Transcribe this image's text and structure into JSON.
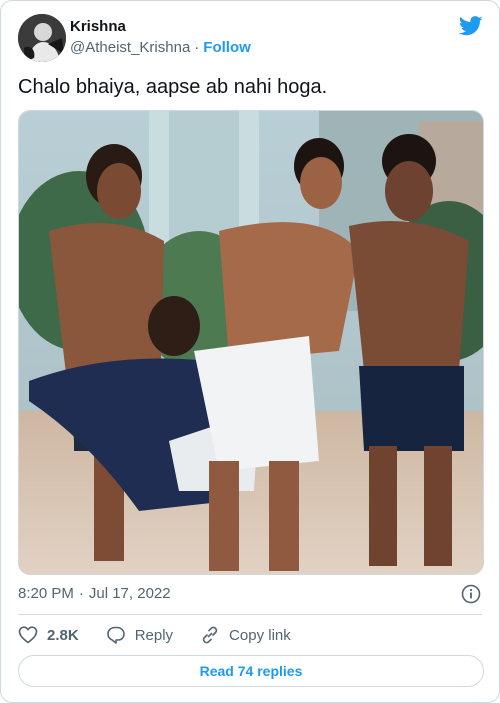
{
  "author": {
    "name": "Krishna",
    "handle": "@Atheist_Krishna",
    "follow_label": "Follow"
  },
  "tweet": {
    "text": "Chalo bhaiya, aapse ab nahi hoga.",
    "time": "8:20 PM",
    "date": "Jul 17, 2022"
  },
  "actions": {
    "likes": "2.8K",
    "reply_label": "Reply",
    "copy_label": "Copy link"
  },
  "replies_button": "Read 74 replies",
  "icons": {
    "brand": "twitter-bird-icon",
    "info": "info-icon",
    "like": "heart-icon",
    "reply": "reply-bubble-icon",
    "copy": "link-icon"
  },
  "colors": {
    "accent": "#1d9bf0",
    "text": "#0f1419",
    "muted": "#536471",
    "border": "#cfd9de"
  }
}
